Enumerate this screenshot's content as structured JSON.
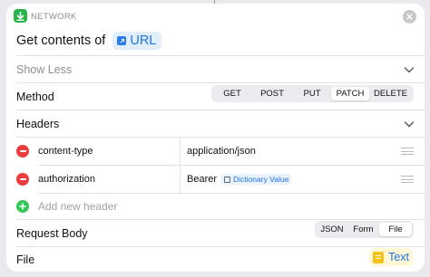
{
  "action": {
    "category": "NETWORK",
    "title": "Get contents of",
    "url_token": "URL"
  },
  "show_less": "Show Less",
  "method": {
    "label": "Method",
    "options": [
      "GET",
      "POST",
      "PUT",
      "PATCH",
      "DELETE"
    ],
    "selected": "PATCH"
  },
  "headers": {
    "label": "Headers",
    "rows": [
      {
        "key": "content-type",
        "value": "application/json"
      },
      {
        "key": "authorization",
        "value": "Bearer",
        "value_token": "Dictionary Value"
      }
    ],
    "add_placeholder": "Add new header"
  },
  "request_body": {
    "label": "Request Body",
    "options": [
      "JSON",
      "Form",
      "File"
    ],
    "selected": "File"
  },
  "file": {
    "label": "File",
    "token": "Text"
  },
  "colors": {
    "accent": "#1a73e8",
    "network_green": "#27b34a",
    "remove_red": "#eb3e3c",
    "add_green": "#33c759"
  }
}
